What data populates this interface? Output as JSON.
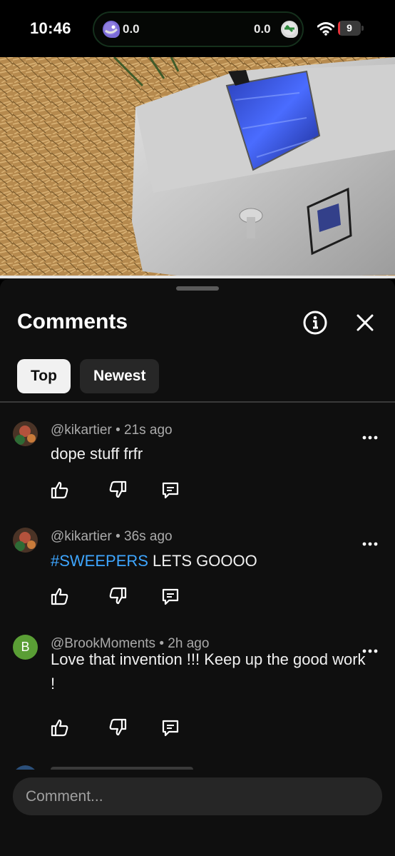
{
  "status_bar": {
    "time": "10:46",
    "score_left": "0.0",
    "score_right": "0.0",
    "battery_level": "9"
  },
  "sheet": {
    "title": "Comments",
    "tabs": [
      {
        "label": "Top",
        "active": true
      },
      {
        "label": "Newest",
        "active": false
      }
    ]
  },
  "comments": [
    {
      "author": "@kikartier",
      "time": "21s ago",
      "text": "dope stuff frfr"
    },
    {
      "author": "@kikartier",
      "time": "36s ago",
      "hashtag": "#SWEEPERS",
      "text": " LETS GOOOO"
    },
    {
      "author": "@BrookMoments",
      "time": "2h ago",
      "avatar_letter": "B",
      "text": "Love that invention !!! Keep up the good work !"
    }
  ],
  "composer": {
    "placeholder": "Comment..."
  },
  "colors": {
    "background": "#0f0f0f",
    "hashtag": "#3ea6ff",
    "avatar_b": "#5a9e35",
    "battery_low": "#e8333a"
  }
}
